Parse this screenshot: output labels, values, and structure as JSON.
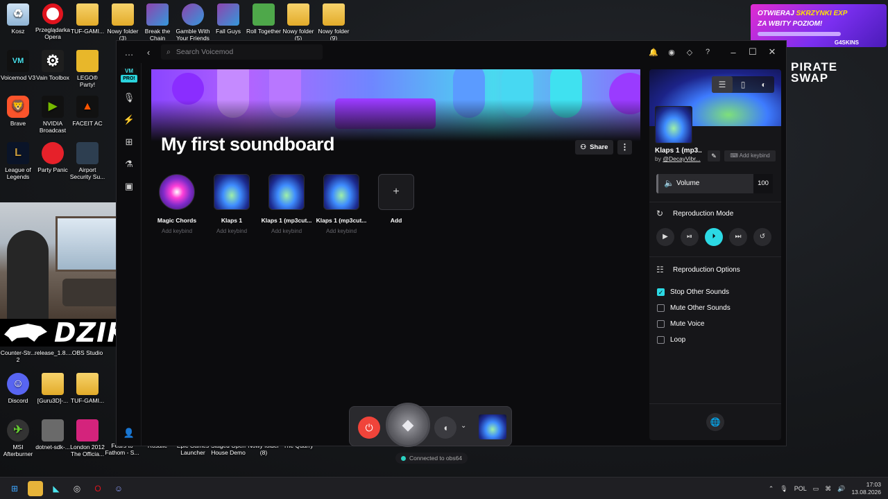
{
  "desktop": {
    "icons": [
      {
        "label": "Kosz"
      },
      {
        "label": "Przeglądarka Opera"
      },
      {
        "label": "TUF-GAMI..."
      },
      {
        "label": "Nowy folder (3)"
      },
      {
        "label": "Break the Chain"
      },
      {
        "label": "Gamble With Your Friends"
      },
      {
        "label": "Fall Guys"
      },
      {
        "label": "Roll Together"
      },
      {
        "label": "Nowy folder (5)"
      },
      {
        "label": "Nowy folder (9)"
      },
      {
        "label": "Voicemod V3"
      },
      {
        "label": "Vain Toolbox"
      },
      {
        "label": "LEGO® Party!"
      },
      {
        "label": "Brave"
      },
      {
        "label": "NVIDIA Broadcast"
      },
      {
        "label": "FACEIT AC"
      },
      {
        "label": "League of Legends"
      },
      {
        "label": "Party Panic"
      },
      {
        "label": "Airport Security Su..."
      },
      {
        "label": "Counter-Str... 2"
      },
      {
        "label": "release_1.8...."
      },
      {
        "label": "OBS Studio"
      },
      {
        "label": "Discord"
      },
      {
        "label": "[Guru3D]-..."
      },
      {
        "label": "TUF-GAMI..."
      },
      {
        "label": "MSI Afterburner"
      },
      {
        "label": "dotnet-sdk-..."
      },
      {
        "label": "London 2012 The Officia..."
      },
      {
        "label": "Fears to Fathom - S..."
      },
      {
        "label": "Rosalie"
      },
      {
        "label": "Epic Games Launcher"
      },
      {
        "label": "Staged Open House Demo"
      },
      {
        "label": "Nowy folder (8)"
      },
      {
        "label": "The Quarry"
      }
    ],
    "overlay_brand": "DZIK",
    "promo": {
      "line1": "OTWIERAJ ",
      "line1_hl": "SKRZYNKI EXP",
      "line2": "ZA WBITY POZIOM!",
      "brand": "G4SKINS"
    },
    "pirate": {
      "line1": "PIRATE",
      "line2": "SWAP"
    }
  },
  "voicemod": {
    "search_placeholder": "Search Voicemod",
    "rail_logo": "VM",
    "rail_pro": "PRO!",
    "soundboard_title": "My first soundboard",
    "share_label": "Share",
    "sounds": [
      {
        "name": "Magic Chords",
        "keybind": "Add keybind"
      },
      {
        "name": "Klaps 1",
        "keybind": "Add keybind"
      },
      {
        "name": "Klaps 1 (mp3cut...",
        "keybind": "Add keybind"
      },
      {
        "name": "Klaps 1 (mp3cut...",
        "keybind": "Add keybind"
      }
    ],
    "add_label": "Add",
    "connection": "Connected to obs64",
    "panel": {
      "sound_name": "Klaps 1 (mp3...",
      "by_prefix": "by ",
      "author": "@DecayVibr...",
      "add_keybind": "Add keybind",
      "volume_label": "Volume",
      "volume_value": "100",
      "reproduction_mode": "Reproduction Mode",
      "reproduction_options": "Reproduction Options",
      "options": [
        {
          "label": "Stop Other Sounds",
          "checked": true
        },
        {
          "label": "Mute Other Sounds",
          "checked": false
        },
        {
          "label": "Mute Voice",
          "checked": false
        },
        {
          "label": "Loop",
          "checked": false
        }
      ]
    }
  },
  "taskbar": {
    "lang": "POL",
    "time": "17:03",
    "date": "13.08.2026"
  }
}
